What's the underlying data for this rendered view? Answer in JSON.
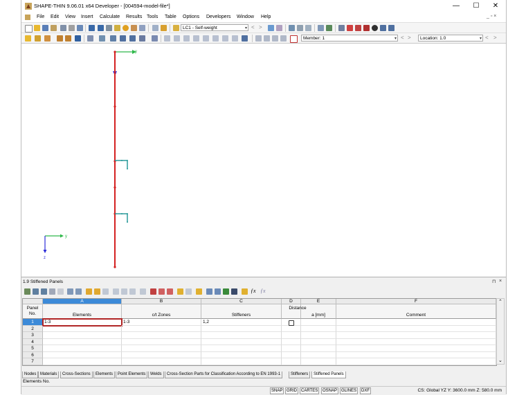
{
  "window": {
    "title": "SHAPE-THIN 9.06.01 x64 Developer - [004594-model-file*]",
    "controls": {
      "minimize": "—",
      "maximize": "☐",
      "close": "✕"
    }
  },
  "menu": {
    "items": [
      "File",
      "Edit",
      "View",
      "Insert",
      "Calculate",
      "Results",
      "Tools",
      "Table",
      "Options",
      "Developers",
      "Window",
      "Help"
    ],
    "mdi_controls": "_ ▫ ×"
  },
  "toolbar1": {
    "load_case": "LC1 - Self-weight"
  },
  "toolbar2": {
    "member_label": "Member: 1",
    "location_label": "Location: 1.0"
  },
  "canvas": {
    "main_axis": {
      "y": "y",
      "z": "z"
    },
    "small_axis": {
      "y": "y",
      "z": "z"
    }
  },
  "panel": {
    "title": "1.9 Stiffened Panels",
    "controls": {
      "pin": "⊓",
      "close": "×"
    },
    "column_letters": [
      "A",
      "B",
      "C",
      "D",
      "E",
      "F"
    ],
    "headers": {
      "panel_no_line1": "Panel",
      "panel_no_line2": "No.",
      "elements": "Elements",
      "ct_zones": "c/t Zones",
      "stiffeners": "Stiffeners",
      "distance_line1": "Distance",
      "distance_line2": "a [mm]",
      "comment": "Comment"
    },
    "rows": [
      {
        "no": "1",
        "elements": "1-3",
        "ct_zones": "1-3",
        "stiffeners": "1,2",
        "checkbox": false,
        "distance": "",
        "comment": ""
      },
      {
        "no": "2",
        "elements": "",
        "ct_zones": "",
        "stiffeners": "",
        "distance": "",
        "comment": ""
      },
      {
        "no": "3",
        "elements": "",
        "ct_zones": "",
        "stiffeners": "",
        "distance": "",
        "comment": ""
      },
      {
        "no": "4",
        "elements": "",
        "ct_zones": "",
        "stiffeners": "",
        "distance": "",
        "comment": ""
      },
      {
        "no": "5",
        "elements": "",
        "ct_zones": "",
        "stiffeners": "",
        "distance": "",
        "comment": ""
      },
      {
        "no": "6",
        "elements": "",
        "ct_zones": "",
        "stiffeners": "",
        "distance": "",
        "comment": ""
      },
      {
        "no": "7",
        "elements": "",
        "ct_zones": "",
        "stiffeners": "",
        "distance": "",
        "comment": ""
      }
    ],
    "tabs": [
      "Nodes",
      "Materials",
      "Cross-Sections",
      "Elements",
      "Point Elements",
      "Welds",
      "Cross-Section Parts for Classification According to EN 1993-1",
      "Stiffeners",
      "Stiffened Panels"
    ],
    "active_tab": "Stiffened Panels",
    "status_text": "Elements No."
  },
  "statusbar": {
    "buttons": [
      "SNAP",
      "GRID",
      "CARTES",
      "OSNAP",
      "GLINES",
      "DXF"
    ],
    "coords": "CS: Global YZ  Y:  3600.0 mm   Z:  580.0 mm"
  },
  "colors": {
    "accent_blue": "#3c8ad8",
    "member_red": "#d42020",
    "active_cell_border": "#b02525"
  }
}
